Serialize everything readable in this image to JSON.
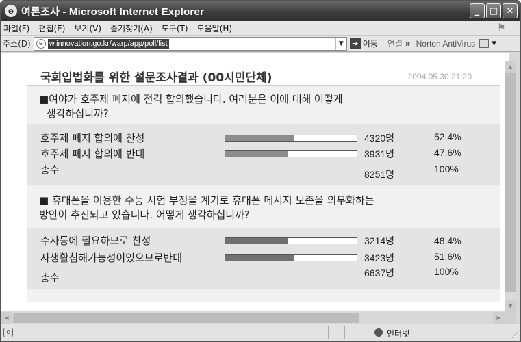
{
  "window": {
    "title": "여론조사 - Microsoft Internet Explorer"
  },
  "menu": {
    "items": [
      "파일(F)",
      "편집(E)",
      "보기(V)",
      "즐겨찾기(A)",
      "도구(T)",
      "도움말(H)"
    ]
  },
  "address": {
    "label": "주소(D)",
    "url": "w.innovation.go.kr/warp/app/poll/list",
    "go_label": "이동",
    "links_label": "연결",
    "chevron": "»",
    "norton_label": "Norton AntiVirus"
  },
  "poll": {
    "title": "국회입법화를 위한 설문조사결과  (00시민단체)",
    "date": "2004.05.30 21:20",
    "questions": [
      {
        "text_line1": "■여야가 호주제 폐지에 전격 합의했습니다. 여러분은 이에 대해 어떻게",
        "text_line2": "생각하십니까?",
        "options": [
          {
            "label": "호주제 폐지 합의에 찬성",
            "count": "4320명",
            "percent": "52.4%",
            "fill": 0.52
          },
          {
            "label": "호주제 폐지 합의에 반대",
            "count": "3931명",
            "percent": "47.6%",
            "fill": 0.48
          }
        ],
        "total": {
          "label": "총수",
          "count": "8251명",
          "percent": "100%"
        }
      },
      {
        "text_line1": "■ 휴대폰을 이용한 수능 시험 부정을 계기로 휴대폰 메시지 보존을 의무화하는",
        "text_line2": "방안이 추진되고 있습니다. 어떻게 생각하십니까?",
        "options": [
          {
            "label": "수사등에 필요하므로 찬성",
            "count": "3214명",
            "percent": "48.4%",
            "fill": 0.48
          },
          {
            "label": "사생활침해가능성이있으므로반대",
            "count": "3423명",
            "percent": "51.6%",
            "fill": 0.52
          }
        ],
        "total": {
          "label": "총수",
          "count": "6637명",
          "percent": "100%"
        }
      }
    ]
  },
  "status": {
    "zone": "인터넷"
  }
}
